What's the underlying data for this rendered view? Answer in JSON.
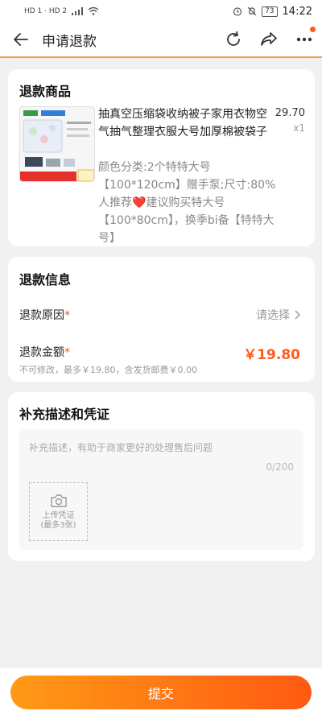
{
  "status_bar": {
    "network_left": "HD 1 · HD 2",
    "battery": "73",
    "time": "14:22"
  },
  "header": {
    "title": "申请退款"
  },
  "goods": {
    "section_title": "退款商品",
    "thumb_tag_left": "折叠款",
    "thumb_tag_right": "特特大号",
    "name": "抽真空压缩袋收纳被子家用衣物空气抽气整理衣服大号加厚棉被袋子",
    "sku": "颜色分类:2个特特大号【100*120cm】赠手泵;尺寸:80%人推荐❤️建议购买特大号【100*80cm】，换季bi备【特特大号】",
    "price": "29.70",
    "qty": "x1"
  },
  "refund_info": {
    "section_title": "退款信息",
    "reason_label": "退款原因",
    "reason_value": "请选择",
    "amount_label": "退款金额",
    "amount_value": "￥19.80",
    "amount_note": "不可修改，最多￥19.80，含发货邮费￥0.00",
    "required_mark": "*"
  },
  "description": {
    "section_title": "补充描述和凭证",
    "placeholder": "补充描述，有助于商家更好的处理售后问题",
    "counter": "0/200",
    "upload_line1": "上传凭证",
    "upload_line2": "(最多3张)"
  },
  "footer": {
    "submit_label": "提交"
  },
  "colors": {
    "accent": "#ff5a1f",
    "gradient_start": "#ff9a16",
    "gradient_end": "#ff5a12",
    "header_underline": "#f3a24c"
  },
  "icons": {
    "back": "arrow-left-icon",
    "refresh": "refresh-icon",
    "share": "share-icon",
    "more": "more-dots-icon",
    "chevron": "chevron-right-icon",
    "camera": "camera-icon"
  }
}
